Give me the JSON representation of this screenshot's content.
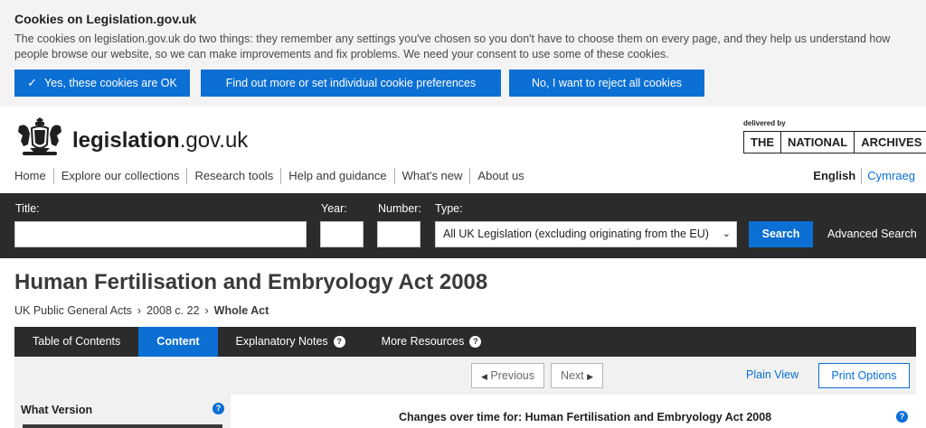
{
  "cookie_banner": {
    "title": "Cookies on Legislation.gov.uk",
    "text": "The cookies on legislation.gov.uk do two things: they remember any settings you've chosen so you don't have to choose them on every page, and they help us understand how people browse our website, so we can make improvements and fix problems. We need your consent to use some of these cookies.",
    "accept_label": "Yes, these cookies are OK",
    "preferences_label": "Find out more or set individual cookie preferences",
    "reject_label": "No, I want to reject all cookies",
    "check_icon": "check-icon"
  },
  "header": {
    "site_name_main": "legislation",
    "site_name_suffix": ".gov.uk",
    "delivered_by": "delivered by",
    "tna_words": [
      "THE",
      "NATIONAL",
      "ARCHIVES"
    ]
  },
  "nav": {
    "items": [
      "Home",
      "Explore our collections",
      "Research tools",
      "Help and guidance",
      "What's new",
      "About us"
    ]
  },
  "language": {
    "english": "English",
    "welsh": "Cymraeg"
  },
  "search": {
    "title_label": "Title:",
    "year_label": "Year:",
    "number_label": "Number:",
    "type_label": "Type:",
    "type_value": "All UK Legislation (excluding originating from the EU)",
    "search_button": "Search",
    "advanced_link": "Advanced Search"
  },
  "page": {
    "title": "Human Fertilisation and Embryology Act 2008",
    "breadcrumb": [
      "UK Public General Acts",
      "2008 c. 22",
      "Whole Act"
    ]
  },
  "tabs": [
    {
      "label": "Table of Contents",
      "active": false,
      "help": false
    },
    {
      "label": "Content",
      "active": true,
      "help": false
    },
    {
      "label": "Explanatory Notes",
      "active": false,
      "help": true
    },
    {
      "label": "More Resources",
      "active": false,
      "help": true
    }
  ],
  "toolbar": {
    "previous_label": "Previous",
    "next_label": "Next",
    "plain_view_label": "Plain View",
    "print_label": "Print Options"
  },
  "sidebar": {
    "what_version_label": "What Version"
  },
  "content": {
    "changes_heading": "Changes over time for: Human Fertilisation and Embryology Act 2008"
  },
  "colors": {
    "accent": "#0b6fd4",
    "dark_bar": "#2b2b2b",
    "banner_bg": "#f3f3f3"
  }
}
